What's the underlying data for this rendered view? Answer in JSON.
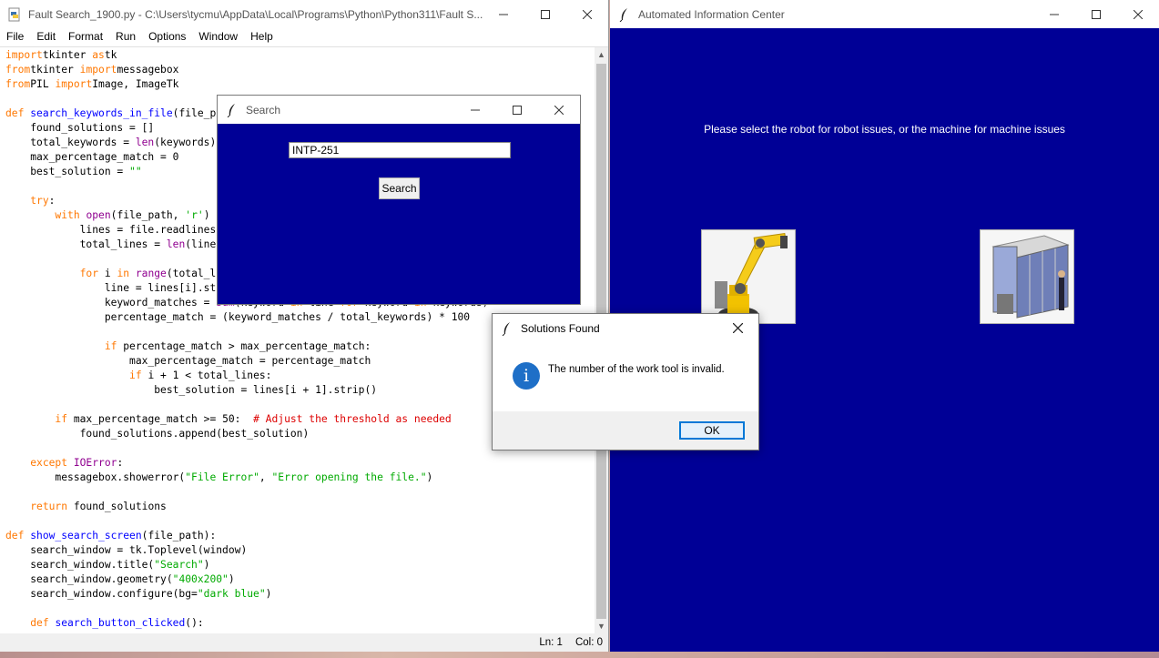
{
  "idle": {
    "title": "Fault Search_1900.py - C:\\Users\\tycmu\\AppData\\Local\\Programs\\Python\\Python311\\Fault S...",
    "menu": [
      "File",
      "Edit",
      "Format",
      "Run",
      "Options",
      "Window",
      "Help"
    ],
    "status": {
      "line": "Ln: 1",
      "col": "Col: 0"
    },
    "code_lines": [
      [
        [
          "kw",
          "import"
        ],
        [
          "",
          "tkinter "
        ],
        [
          "kw",
          "as"
        ],
        [
          "",
          "tk"
        ]
      ],
      [
        [
          "kw",
          "from"
        ],
        [
          "",
          "tkinter "
        ],
        [
          "kw",
          "import"
        ],
        [
          "",
          "messagebox"
        ]
      ],
      [
        [
          "kw",
          "from"
        ],
        [
          "",
          "PIL "
        ],
        [
          "kw",
          "import"
        ],
        [
          "",
          "Image, ImageTk"
        ]
      ],
      [],
      [
        [
          "kw",
          "def "
        ],
        [
          "fn",
          "search_keywords_in_file"
        ],
        [
          "",
          "(file_path, keywords):"
        ]
      ],
      [
        [
          "",
          "    found_solutions = []"
        ]
      ],
      [
        [
          "",
          "    total_keywords = "
        ],
        [
          "bi",
          "len"
        ],
        [
          "",
          "(keywords)"
        ]
      ],
      [
        [
          "",
          "    max_percentage_match = 0"
        ]
      ],
      [
        [
          "",
          "    best_solution = "
        ],
        [
          "st",
          "\"\""
        ]
      ],
      [],
      [
        [
          "",
          "    "
        ],
        [
          "kw",
          "try"
        ],
        [
          "",
          ":"
        ]
      ],
      [
        [
          "",
          "        "
        ],
        [
          "kw",
          "with "
        ],
        [
          "bi",
          "open"
        ],
        [
          "",
          "(file_path, "
        ],
        [
          "st",
          "'r'"
        ],
        [
          "",
          ") "
        ],
        [
          "kw",
          "as"
        ],
        [
          "",
          " file:"
        ]
      ],
      [
        [
          "",
          "            lines = file.readlines()"
        ]
      ],
      [
        [
          "",
          "            total_lines = "
        ],
        [
          "bi",
          "len"
        ],
        [
          "",
          "(lines)"
        ]
      ],
      [],
      [
        [
          "",
          "            "
        ],
        [
          "kw",
          "for"
        ],
        [
          "",
          " i "
        ],
        [
          "kw",
          "in "
        ],
        [
          "bi",
          "range"
        ],
        [
          "",
          "(total_lines):"
        ]
      ],
      [
        [
          "",
          "                line = lines[i].strip().lower()"
        ]
      ],
      [
        [
          "",
          "                keyword_matches = "
        ],
        [
          "bi",
          "sum"
        ],
        [
          "",
          "(keyword "
        ],
        [
          "kw",
          "in"
        ],
        [
          "",
          " line "
        ],
        [
          "kw",
          "for"
        ],
        [
          "",
          " keyword "
        ],
        [
          "kw",
          "in"
        ],
        [
          "",
          " keywords)"
        ]
      ],
      [
        [
          "",
          "                percentage_match = (keyword_matches / total_keywords) * 100"
        ]
      ],
      [],
      [
        [
          "",
          "                "
        ],
        [
          "kw",
          "if"
        ],
        [
          "",
          " percentage_match > max_percentage_match:"
        ]
      ],
      [
        [
          "",
          "                    max_percentage_match = percentage_match"
        ]
      ],
      [
        [
          "",
          "                    "
        ],
        [
          "kw",
          "if"
        ],
        [
          "",
          " i + 1 < total_lines:"
        ]
      ],
      [
        [
          "",
          "                        best_solution = lines[i + 1].strip()"
        ]
      ],
      [],
      [
        [
          "",
          "        "
        ],
        [
          "kw",
          "if"
        ],
        [
          "",
          " max_percentage_match >= 50:  "
        ],
        [
          "cm",
          "# Adjust the threshold as needed"
        ]
      ],
      [
        [
          "",
          "            found_solutions.append(best_solution)"
        ]
      ],
      [],
      [
        [
          "",
          "    "
        ],
        [
          "kw",
          "except "
        ],
        [
          "bi",
          "IOError"
        ],
        [
          "",
          ":"
        ]
      ],
      [
        [
          "",
          "        messagebox.showerror("
        ],
        [
          "st",
          "\"File Error\""
        ],
        [
          "",
          ", "
        ],
        [
          "st",
          "\"Error opening the file.\""
        ],
        [
          "",
          ")"
        ]
      ],
      [],
      [
        [
          "",
          "    "
        ],
        [
          "kw",
          "return"
        ],
        [
          "",
          " found_solutions"
        ]
      ],
      [],
      [
        [
          "kw",
          "def "
        ],
        [
          "fn",
          "show_search_screen"
        ],
        [
          "",
          "(file_path):"
        ]
      ],
      [
        [
          "",
          "    search_window = tk.Toplevel(window)"
        ]
      ],
      [
        [
          "",
          "    search_window.title("
        ],
        [
          "st",
          "\"Search\""
        ],
        [
          "",
          ")"
        ]
      ],
      [
        [
          "",
          "    search_window.geometry("
        ],
        [
          "st",
          "\"400x200\""
        ],
        [
          "",
          ")"
        ]
      ],
      [
        [
          "",
          "    search_window.configure(bg="
        ],
        [
          "st",
          "\"dark blue\""
        ],
        [
          "",
          ")"
        ]
      ],
      [],
      [
        [
          "",
          "    "
        ],
        [
          "kw",
          "def "
        ],
        [
          "fn",
          "search_button_clicked"
        ],
        [
          "",
          "():"
        ]
      ]
    ]
  },
  "aic": {
    "title": "Automated Information Center",
    "prompt": "Please select the robot for robot issues, or the machine for machine issues"
  },
  "search": {
    "title": "Search",
    "input_value": "INTP-251",
    "button": "Search"
  },
  "dialog": {
    "title": "Solutions Found",
    "message": "The number of the work tool is invalid.",
    "ok": "OK"
  },
  "colors": {
    "dark_blue": "#000096",
    "kw": "#ff7700",
    "builtin": "#900090",
    "def_name": "#0000ff",
    "string": "#00aa00",
    "comment": "#dd0000"
  }
}
